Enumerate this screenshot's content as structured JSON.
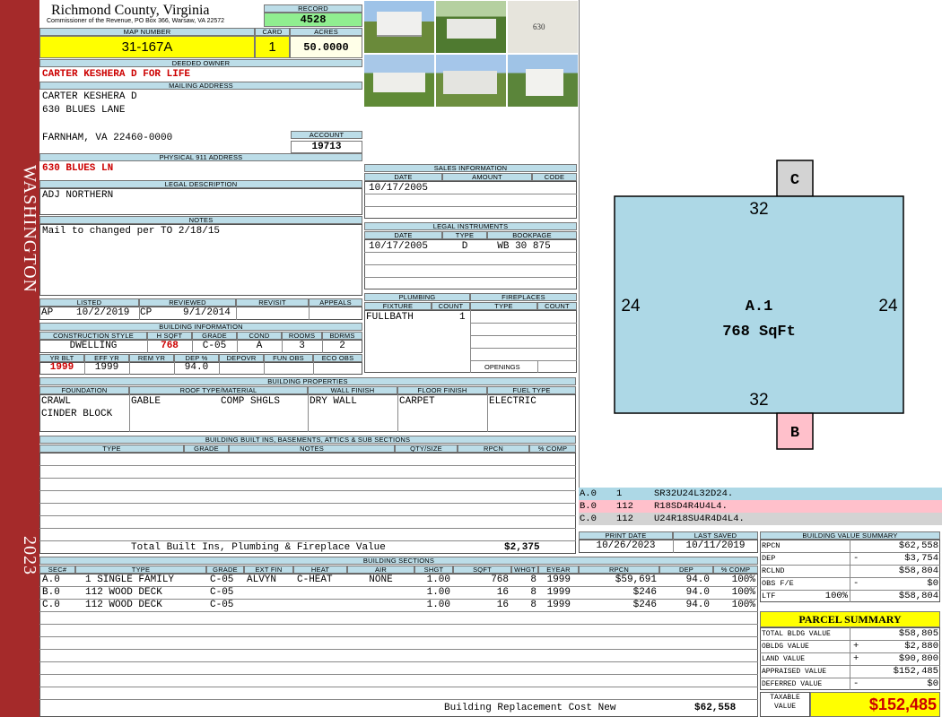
{
  "county": {
    "name": "Richmond County, Virginia",
    "address": "Commissioner of the Revenue, PO Box 366, Warsaw, VA 22572"
  },
  "sidebar": {
    "district": "WASHINGTON",
    "year": "2023"
  },
  "record": {
    "label": "RECORD",
    "value": "4528"
  },
  "map_number": {
    "label": "MAP NUMBER",
    "value": "31-167A"
  },
  "card": {
    "label": "CARD",
    "value": "1"
  },
  "acres": {
    "label": "ACRES",
    "value": "50.0000"
  },
  "deeded_owner": {
    "label": "DEEDED OWNER",
    "value": "CARTER KESHERA D FOR LIFE"
  },
  "mailing": {
    "label": "MAILING ADDRESS",
    "line1": "CARTER KESHERA D",
    "line2": "630 BLUES LANE",
    "line3": "FARNHAM, VA 22460-0000"
  },
  "account": {
    "label": "ACCOUNT",
    "value": "19713"
  },
  "physical_address": {
    "label": "PHYSICAL 911 ADDRESS",
    "value": "630 BLUES LN"
  },
  "legal_description": {
    "label": "LEGAL DESCRIPTION",
    "value": "ADJ NORTHERN"
  },
  "notes": {
    "label": "NOTES",
    "value": "Mail to changed per TO 2/18/15"
  },
  "status": {
    "listed_label": "LISTED",
    "listed_by": "AP",
    "listed_date": "10/2/2019",
    "reviewed_label": "REVIEWED",
    "reviewed_by": "CP",
    "reviewed_date": "9/1/2014",
    "revisit_label": "REVISIT",
    "appeals_label": "APPEALS"
  },
  "building_info": {
    "label": "BUILDING INFORMATION",
    "h": [
      "CONSTRUCTION STYLE",
      "H SQFT",
      "GRADE",
      "COND",
      "ROOMS",
      "BDRMS"
    ],
    "style": "DWELLING",
    "hsqft": "768",
    "grade": "C-05",
    "cond": "A",
    "rooms": "3",
    "bdrms": "2",
    "h2": [
      "YR BLT",
      "EFF YR",
      "REM YR",
      "DEP %",
      "DEPOVR",
      "FUN OBS",
      "ECO OBS"
    ],
    "yr_blt": "1999",
    "eff_yr": "1999",
    "dep": "94.0"
  },
  "sales": {
    "label": "SALES INFORMATION",
    "h": [
      "DATE",
      "AMOUNT",
      "CODE"
    ],
    "date": "10/17/2005"
  },
  "legal_instruments": {
    "label": "LEGAL INSTRUMENTS",
    "h": [
      "DATE",
      "TYPE",
      "BOOKPAGE"
    ],
    "date": "10/17/2005",
    "type": "D",
    "bookpage": "WB 30 875"
  },
  "plumbing": {
    "label": "PLUMBING",
    "h": [
      "FIXTURE",
      "COUNT"
    ],
    "fixture": "FULLBATH",
    "count": "1"
  },
  "fireplaces": {
    "label": "FIREPLACES",
    "h": [
      "TYPE",
      "COUNT"
    ],
    "openings": "OPENINGS"
  },
  "properties": {
    "label": "BUILDING PROPERTIES",
    "h": [
      "FOUNDATION",
      "ROOF TYPE/MATERIAL",
      "WALL FINISH",
      "FLOOR FINISH",
      "FUEL TYPE"
    ],
    "foundation1": "CRAWL",
    "foundation2": "CINDER BLOCK",
    "roof_type": "GABLE",
    "roof_material": "COMP SHGLS",
    "wall": "DRY WALL",
    "floor": "CARPET",
    "fuel": "ELECTRIC"
  },
  "builtins": {
    "label": "BUILDING BUILT INS, BASEMENTS, ATTICS & SUB SECTIONS",
    "h": [
      "TYPE",
      "GRADE",
      "NOTES",
      "QTY/SIZE",
      "RPCN",
      "% COMP"
    ],
    "total_label": "Total Built Ins, Plumbing & Fireplace Value",
    "total_value": "$2,375"
  },
  "dates": {
    "print_label": "PRINT DATE",
    "print_value": "10/26/2023",
    "saved_label": "LAST SAVED",
    "saved_value": "10/11/2019"
  },
  "sections": {
    "label": "BUILDING SECTIONS",
    "h": [
      "SEC#",
      "TYPE",
      "GRADE",
      "EXT FIN",
      "HEAT",
      "AIR",
      "SHGT",
      "SQFT",
      "WHGT",
      "EYEAR",
      "RPCN",
      "DEP",
      "% COMP"
    ],
    "rows": [
      [
        "A.0",
        "1 SINGLE FAMILY",
        "C-05",
        "ALVYN",
        "C-HEAT",
        "NONE",
        "1.00",
        "768",
        "8",
        "1999",
        "$59,691",
        "94.0",
        "100%"
      ],
      [
        "B.0",
        "112 WOOD DECK",
        "C-05",
        "",
        "",
        "",
        "1.00",
        "16",
        "8",
        "1999",
        "$246",
        "94.0",
        "100%"
      ],
      [
        "C.0",
        "112 WOOD DECK",
        "C-05",
        "",
        "",
        "",
        "1.00",
        "16",
        "8",
        "1999",
        "$246",
        "94.0",
        "100%"
      ]
    ],
    "replacement_label": "Building Replacement Cost New",
    "replacement_value": "$62,558"
  },
  "sketch": {
    "main_label": "A.1",
    "main_area": "768 SqFt",
    "top": "32",
    "bottom": "32",
    "left": "24",
    "right": "24",
    "label_c": "C",
    "label_b": "B",
    "colors": {
      "main": "#add8e6",
      "c": "#d3d3d3",
      "b": "#ffc0cb"
    }
  },
  "vectors": [
    {
      "sec": "A.0",
      "code": "1",
      "vec": "SR32U24L32D24.",
      "color": "#add8e6"
    },
    {
      "sec": "B.0",
      "code": "112",
      "vec": "R18SD4R4U4L4.",
      "color": "#ffc0cb"
    },
    {
      "sec": "C.0",
      "code": "112",
      "vec": "U24R18SU4R4D4L4.",
      "color": "#d3d3d3"
    }
  ],
  "value_summary": {
    "label": "BUILDING VALUE SUMMARY",
    "rows": [
      {
        "k": "RPCN",
        "sign": "",
        "pct": "",
        "v": "$62,558"
      },
      {
        "k": "DEP",
        "sign": "-",
        "pct": "",
        "v": "$3,754"
      },
      {
        "k": "RCLND",
        "sign": "",
        "pct": "",
        "v": "$58,804"
      },
      {
        "k": "OBS F/E",
        "sign": "-",
        "pct": "",
        "v": "$0"
      },
      {
        "k": "LTF",
        "sign": "",
        "pct": "100%",
        "v": "$58,804"
      }
    ]
  },
  "parcel": {
    "label": "PARCEL SUMMARY",
    "rows": [
      {
        "k": "TOTAL BLDG VALUE",
        "sign": "",
        "v": "$58,805"
      },
      {
        "k": "OBLDG VALUE",
        "sign": "+",
        "v": "$2,880"
      },
      {
        "k": "LAND VALUE",
        "sign": "+",
        "v": "$90,800"
      },
      {
        "k": "APPRAISED VALUE",
        "sign": "",
        "v": "$152,485"
      },
      {
        "k": "DEFERRED VALUE",
        "sign": "-",
        "v": "$0"
      }
    ],
    "taxable_label1": "TAXABLE",
    "taxable_label2": "VALUE",
    "taxable_value": "$152,485"
  },
  "photo_caption": "630"
}
